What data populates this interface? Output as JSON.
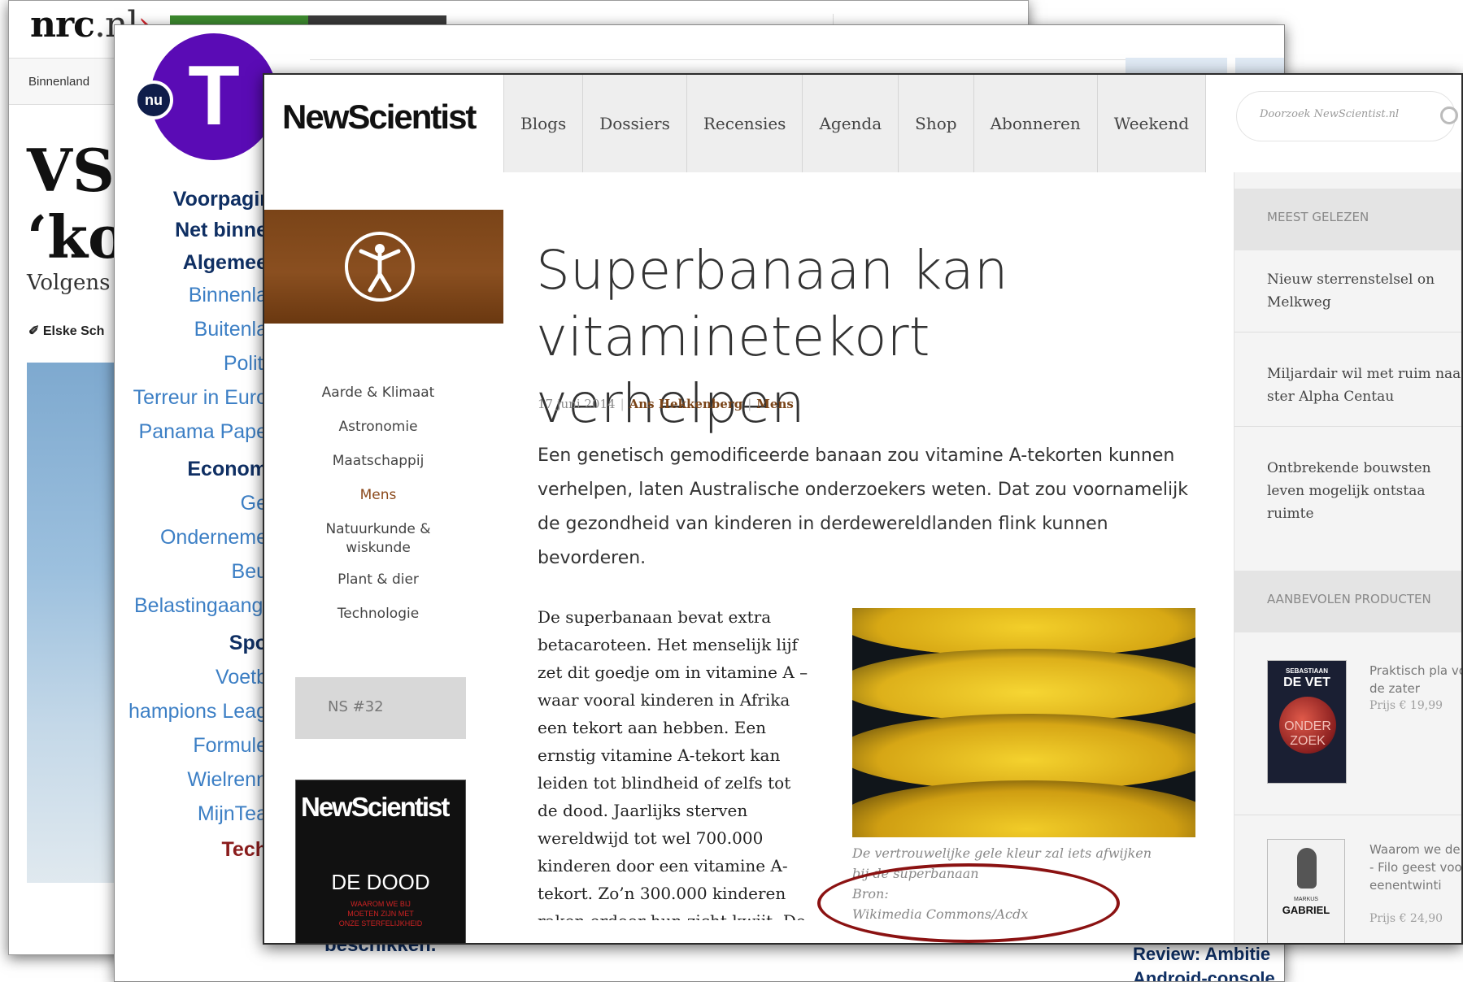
{
  "nrc": {
    "logo_name": "nrc",
    "logo_tld": ".nl",
    "logo_caret": "›",
    "nav_item": "Binnenland",
    "headline": "VS l\n‘ko",
    "lede": "Volgens",
    "author": "✐ Elske Sch"
  },
  "nu": {
    "badge": "nu",
    "logo_letter": "T",
    "menu": [
      {
        "label": "Voorpagir",
        "style": "strong"
      },
      {
        "label": "Net binne",
        "style": "strong"
      },
      {
        "label": "Algemee",
        "style": "strong"
      },
      {
        "label": "Binnenla",
        "style": "link"
      },
      {
        "label": "Buitenla",
        "style": "link"
      },
      {
        "label": "Politi",
        "style": "link"
      },
      {
        "label": "Terreur in Euro",
        "style": "link"
      },
      {
        "label": "Panama Pape",
        "style": "link"
      },
      {
        "label": "Econom",
        "style": "strong"
      },
      {
        "label": "Ge",
        "style": "link"
      },
      {
        "label": "Onderneme",
        "style": "link"
      },
      {
        "label": "Beu",
        "style": "link"
      },
      {
        "label": "Belastingaangi",
        "style": "link"
      },
      {
        "label": "Spo",
        "style": "strong"
      },
      {
        "label": "Voetb",
        "style": "link"
      },
      {
        "label": "hampions Leag",
        "style": "link"
      },
      {
        "label": "Formule",
        "style": "link"
      },
      {
        "label": "Wielrenn",
        "style": "link"
      },
      {
        "label": "MijnTea",
        "style": "link"
      },
      {
        "label": "Tech",
        "style": "tech"
      }
    ],
    "body_fragment": "beschikken.",
    "review_line1": "Review: Ambitie",
    "review_line2": "Android-console"
  },
  "ns": {
    "logo": "NewScientist",
    "nav": [
      "Blogs",
      "Dossiers",
      "Recensies",
      "Agenda",
      "Shop",
      "Abonneren",
      "Weekend"
    ],
    "search_placeholder": "Doorzoek NewScientist.nl",
    "categories": [
      {
        "label": "Aarde & Klimaat",
        "active": false
      },
      {
        "label": "Astronomie",
        "active": false
      },
      {
        "label": "Maatschappij",
        "active": false
      },
      {
        "label": "Mens",
        "active": true
      },
      {
        "label": "Natuurkunde &\nwiskunde",
        "active": false
      },
      {
        "label": "Plant & dier",
        "active": false
      },
      {
        "label": "Technologie",
        "active": false
      }
    ],
    "issue_label": "NS #32",
    "magazine": {
      "logo": "NewScientist",
      "title": "DE DOOD",
      "subtitle": "WAAROM WE BIJ\nMOETEN ZIJN MET\nONZE STERFELIJKHEID"
    },
    "article": {
      "title": "Superbanaan kan vitaminetekort verhelpen",
      "date": "17 juni 2014",
      "author": "Ans Hekkenberg",
      "category": "Mens",
      "intro": "Een genetisch gemodificeerde banaan zou vitamine A-tekorten kunnen verhelpen, laten Australische onderzoekers weten. Dat zou voornamelijk de gezondheid van kinderen in derdewereldlanden flink kunnen bevorderen.",
      "body": "De superbanaan bevat extra betacaroteen. Het menselijk lijf zet dit goedje om in vitamine A – waar vooral kinderen in Afrika een tekort aan hebben. Een ernstig vitamine A-tekort kan leiden tot blindheid of zelfs tot de dood. Jaarlijks sterven wereldwijd tot wel 700.000 kinderen door een vitamine A-tekort. Zo’n 300.000 kinderen raken erdoor hun zicht kwijt. De onderzoekers",
      "caption": "De vertrouwelijke gele kleur zal iets afwijken bij de superbanaan",
      "source_label": "Bron:",
      "source": "Wikimedia Commons/Acdx"
    },
    "sidebar": {
      "most_read_heading": "MEEST GELEZEN",
      "most_read": [
        "Nieuw sterrenstelsel on Melkweg",
        "Miljardair wil met ruim naar ster Alpha Centau",
        "Ontbrekende bouwsten leven mogelijk ontstaa ruimte"
      ],
      "products_heading": "AANBEVOLEN PRODUCTEN",
      "products": [
        {
          "title": "Praktisch pla voor de zater",
          "price": "Prijs € 19,99",
          "cover_author": "SEBASTIAAN",
          "cover_title": "DE VET",
          "cover_sub": "ONDER ZOEK"
        },
        {
          "title": "Waarom we denken - Filo geest voor d eenentwinti",
          "price": "Prijs € 24,90",
          "cover_author": "MARKUS",
          "cover_title": "GABRIEL"
        }
      ]
    },
    "colors": {
      "accent_brown": "#8c4a1c",
      "annotation_red": "#8b1212",
      "nu_purple": "#5a0bb5"
    }
  }
}
